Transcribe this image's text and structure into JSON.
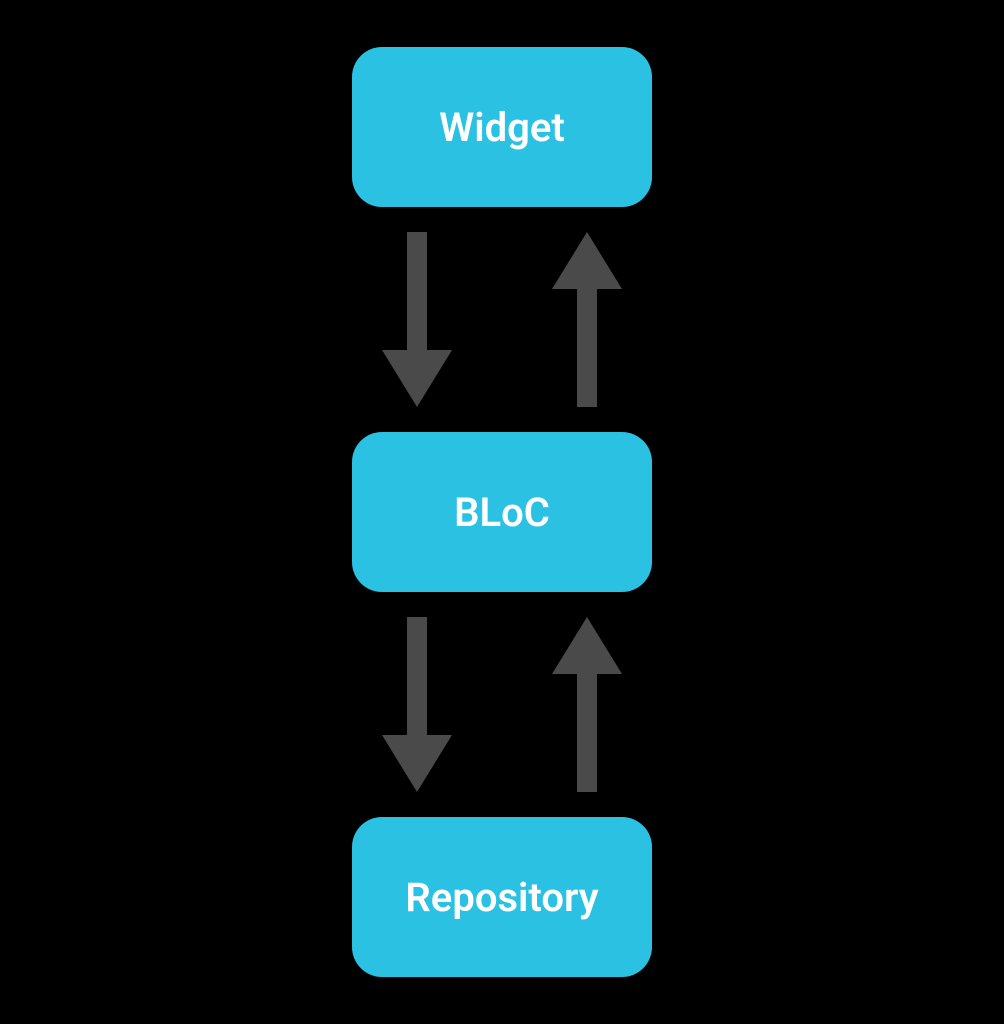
{
  "nodes": {
    "top": {
      "label": "Widget"
    },
    "middle": {
      "label": "BLoC"
    },
    "bottom": {
      "label": "Repository"
    }
  },
  "colors": {
    "node_bg": "#2ac1e2",
    "node_text": "#ffffff",
    "arrow": "#4a4a4a",
    "background": "#000000"
  }
}
